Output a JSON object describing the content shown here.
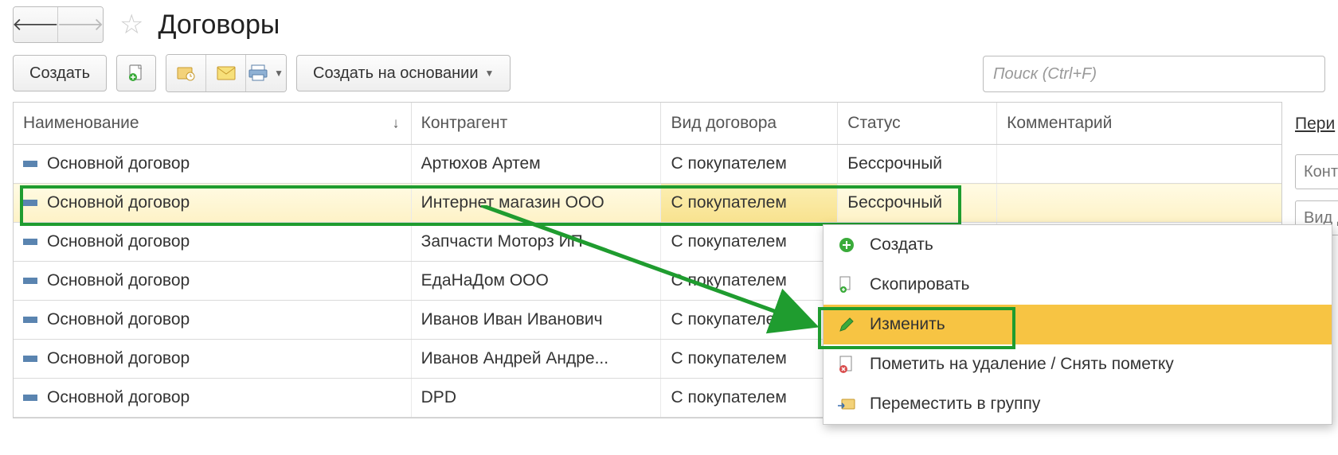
{
  "header": {
    "title": "Договоры"
  },
  "toolbar": {
    "create_label": "Создать",
    "create_based_on_label": "Создать на основании"
  },
  "search": {
    "placeholder": "Поиск (Ctrl+F)"
  },
  "columns": {
    "name": "Наименование",
    "counterparty": "Контрагент",
    "contract_type": "Вид договора",
    "status": "Статус",
    "comment": "Комментарий"
  },
  "rows": [
    {
      "name": "Основной договор",
      "cp": "Артюхов Артем",
      "type": "С покупателем",
      "status": "Бессрочный",
      "comment": ""
    },
    {
      "name": "Основной договор",
      "cp": "Интернет магазин ООО",
      "type": "С покупателем",
      "status": "Бессрочный",
      "comment": ""
    },
    {
      "name": "Основной договор",
      "cp": "Запчасти Моторз ИП",
      "type": "С покупателем",
      "status": "",
      "comment": ""
    },
    {
      "name": "Основной договор",
      "cp": "ЕдаНаДом ООО",
      "type": "С покупателем",
      "status": "",
      "comment": ""
    },
    {
      "name": "Основной договор",
      "cp": "Иванов Иван Иванович",
      "type": "С покупателем",
      "status": "",
      "comment": ""
    },
    {
      "name": "Основной договор",
      "cp": "Иванов Андрей Андре...",
      "type": "С покупателем",
      "status": "",
      "comment": ""
    },
    {
      "name": "Основной договор",
      "cp": "DPD",
      "type": "С покупателем",
      "status": "",
      "comment": ""
    }
  ],
  "context_menu": {
    "create": "Создать",
    "copy": "Скопировать",
    "edit": "Изменить",
    "mark_delete": "Пометить на удаление / Снять пометку",
    "move_group": "Переместить в группу"
  },
  "side": {
    "period_link": "Пери",
    "filter1_placeholder": "Контр",
    "filter2_placeholder": "Вид д"
  }
}
